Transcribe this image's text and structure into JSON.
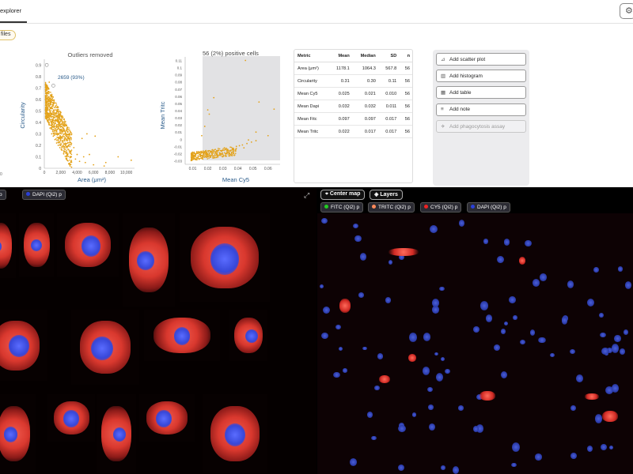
{
  "header": {
    "tab_label": "explorer",
    "settings_icon": "gear-icon"
  },
  "files_chip": "files",
  "scatter1": {
    "title": "Outliers removed",
    "xlabel": "Area (μm²)",
    "ylabel": "Circularity",
    "annotation": "2659 (93%)",
    "x_ticks": [
      "0",
      "2,000",
      "4,000",
      "6,000",
      "8,000",
      "10,000"
    ],
    "y_ticks": [
      "0",
      "0.1",
      "0.2",
      "0.3",
      "0.4",
      "0.5",
      "0.6",
      "0.7",
      "0.8",
      "0.9"
    ],
    "edge_label": "0",
    "point_color": "#e3a21a"
  },
  "scatter2": {
    "title": "56 (2%) positive cells",
    "xlabel": "Mean Cy5",
    "ylabel": "Mean Tritc",
    "x_ticks": [
      "0.01",
      "0.02",
      "0.03",
      "0.04",
      "0.05",
      "0.06"
    ],
    "y_ticks": [
      "-0.03",
      "-0.02",
      "-0.01",
      "0",
      "0.01",
      "0.02",
      "0.03",
      "0.04",
      "0.05",
      "0.06",
      "0.07",
      "0.08",
      "0.09",
      "0.1",
      "0.11"
    ],
    "point_color": "#e3a21a",
    "gate_color": "#e2e2e4"
  },
  "chart_data": [
    {
      "type": "scatter",
      "title": "Outliers removed",
      "xlabel": "Area (μm²)",
      "ylabel": "Circularity",
      "xlim": [
        0,
        11000
      ],
      "ylim": [
        0,
        0.95
      ],
      "annotation": "2659 (93%)",
      "points": [
        [
          300,
          0.55
        ],
        [
          500,
          0.42
        ],
        [
          700,
          0.35
        ],
        [
          900,
          0.3
        ],
        [
          1100,
          0.28
        ],
        [
          1300,
          0.25
        ],
        [
          1500,
          0.22
        ],
        [
          1700,
          0.2
        ],
        [
          1900,
          0.18
        ],
        [
          2100,
          0.16
        ],
        [
          2400,
          0.14
        ],
        [
          2800,
          0.12
        ],
        [
          3300,
          0.1
        ],
        [
          3800,
          0.08
        ],
        [
          4300,
          0.06
        ],
        [
          5000,
          0.05
        ],
        [
          6000,
          0.03
        ],
        [
          7300,
          0.02
        ],
        [
          400,
          0.7
        ],
        [
          600,
          0.62
        ],
        [
          800,
          0.5
        ],
        [
          1000,
          0.45
        ],
        [
          1200,
          0.38
        ],
        [
          1400,
          0.33
        ],
        [
          1600,
          0.29
        ],
        [
          2000,
          0.24
        ],
        [
          2600,
          0.2
        ],
        [
          3200,
          0.15
        ],
        [
          4000,
          0.12
        ],
        [
          4800,
          0.1
        ],
        [
          5500,
          0.12
        ],
        [
          6200,
          0.28
        ],
        [
          7500,
          0.05
        ],
        [
          10600,
          0.07
        ],
        [
          9000,
          0.1
        ],
        [
          5200,
          0.3
        ],
        [
          4600,
          0.26
        ],
        [
          3600,
          0.18
        ],
        [
          2300,
          0.32
        ],
        [
          1800,
          0.4
        ],
        [
          1500,
          0.48
        ],
        [
          1100,
          0.55
        ],
        [
          800,
          0.63
        ],
        [
          600,
          0.75
        ]
      ]
    },
    {
      "type": "scatter",
      "title": "56 (2%) positive cells",
      "xlabel": "Mean Cy5",
      "ylabel": "Mean Tritc",
      "xlim": [
        0.005,
        0.068
      ],
      "ylim": [
        -0.035,
        0.115
      ],
      "points": [
        [
          0.012,
          -0.028
        ],
        [
          0.014,
          -0.027
        ],
        [
          0.016,
          -0.026
        ],
        [
          0.018,
          -0.025
        ],
        [
          0.02,
          -0.024
        ],
        [
          0.022,
          -0.024
        ],
        [
          0.024,
          -0.023
        ],
        [
          0.026,
          -0.022
        ],
        [
          0.028,
          -0.022
        ],
        [
          0.03,
          -0.021
        ],
        [
          0.013,
          -0.02
        ],
        [
          0.017,
          -0.019
        ],
        [
          0.021,
          -0.02
        ],
        [
          0.025,
          -0.018
        ],
        [
          0.029,
          -0.016
        ],
        [
          0.033,
          -0.015
        ],
        [
          0.011,
          -0.024
        ],
        [
          0.015,
          -0.022
        ],
        [
          0.019,
          -0.021
        ],
        [
          0.023,
          -0.019
        ],
        [
          0.027,
          -0.013
        ],
        [
          0.031,
          -0.012
        ],
        [
          0.035,
          -0.011
        ],
        [
          0.039,
          -0.01
        ],
        [
          0.041,
          -0.009
        ],
        [
          0.043,
          -0.008
        ],
        [
          0.046,
          -0.006
        ],
        [
          0.049,
          -0.004
        ],
        [
          0.052,
          -0.002
        ],
        [
          0.016,
          0.005
        ],
        [
          0.018,
          0.018
        ],
        [
          0.021,
          0.035
        ],
        [
          0.02,
          0.041
        ],
        [
          0.024,
          0.058
        ],
        [
          0.015,
          -0.018
        ],
        [
          0.032,
          -0.02
        ],
        [
          0.036,
          -0.018
        ],
        [
          0.026,
          -0.017
        ],
        [
          0.044,
          -0.012
        ],
        [
          0.047,
          -0.001
        ],
        [
          0.052,
          0.01
        ],
        [
          0.054,
          0.052
        ],
        [
          0.064,
          0.042
        ],
        [
          0.045,
          0.11
        ],
        [
          0.06,
          0.005
        ]
      ]
    }
  ],
  "metrics_table": {
    "headers": [
      "Metric",
      "Mean",
      "Median",
      "SD",
      "n"
    ],
    "rows": [
      [
        "Area (μm²)",
        "1178.1",
        "1064.3",
        "567.8",
        "56"
      ],
      [
        "Circularity",
        "0.31",
        "0.30",
        "0.11",
        "56"
      ],
      [
        "Mean Cy5",
        "0.025",
        "0.021",
        "0.010",
        "56"
      ],
      [
        "Mean Dapi",
        "0.032",
        "0.032",
        "0.011",
        "56"
      ],
      [
        "Mean Fitc",
        "0.097",
        "0.097",
        "0.017",
        "56"
      ],
      [
        "Mean Tritc",
        "0.022",
        "0.017",
        "0.017",
        "56"
      ]
    ]
  },
  "actions": [
    {
      "label": "Add scatter plot",
      "icon": "scatter-plot-icon",
      "glyph": "⊿",
      "disabled": false
    },
    {
      "label": "Add histogram",
      "icon": "histogram-icon",
      "glyph": "▥",
      "disabled": false
    },
    {
      "label": "Add table",
      "icon": "table-icon",
      "glyph": "▦",
      "disabled": false
    },
    {
      "label": "Add note",
      "icon": "note-icon",
      "glyph": "≡",
      "disabled": false
    },
    {
      "label": "Add phagocytosis assay",
      "icon": "assay-icon",
      "glyph": "✧",
      "disabled": true
    }
  ],
  "gallery": {
    "channels": [
      {
        "label": "p",
        "color": "#888888"
      },
      {
        "label": "DAPI (Qi2) p",
        "color": "#2a40d8"
      }
    ],
    "expand_icon": "expand-icon"
  },
  "map": {
    "center_label": "Center map",
    "layers_label": "Layers",
    "channels": [
      {
        "label": "FITC (Qi2) p",
        "color": "#22cc22"
      },
      {
        "label": "TRITC (Qi2) p",
        "color": "#ff8a5a"
      },
      {
        "label": "CY5 (Qi2) p",
        "color": "#ee2222"
      },
      {
        "label": "DAPI (Qi2) p",
        "color": "#2a40d8"
      }
    ]
  }
}
